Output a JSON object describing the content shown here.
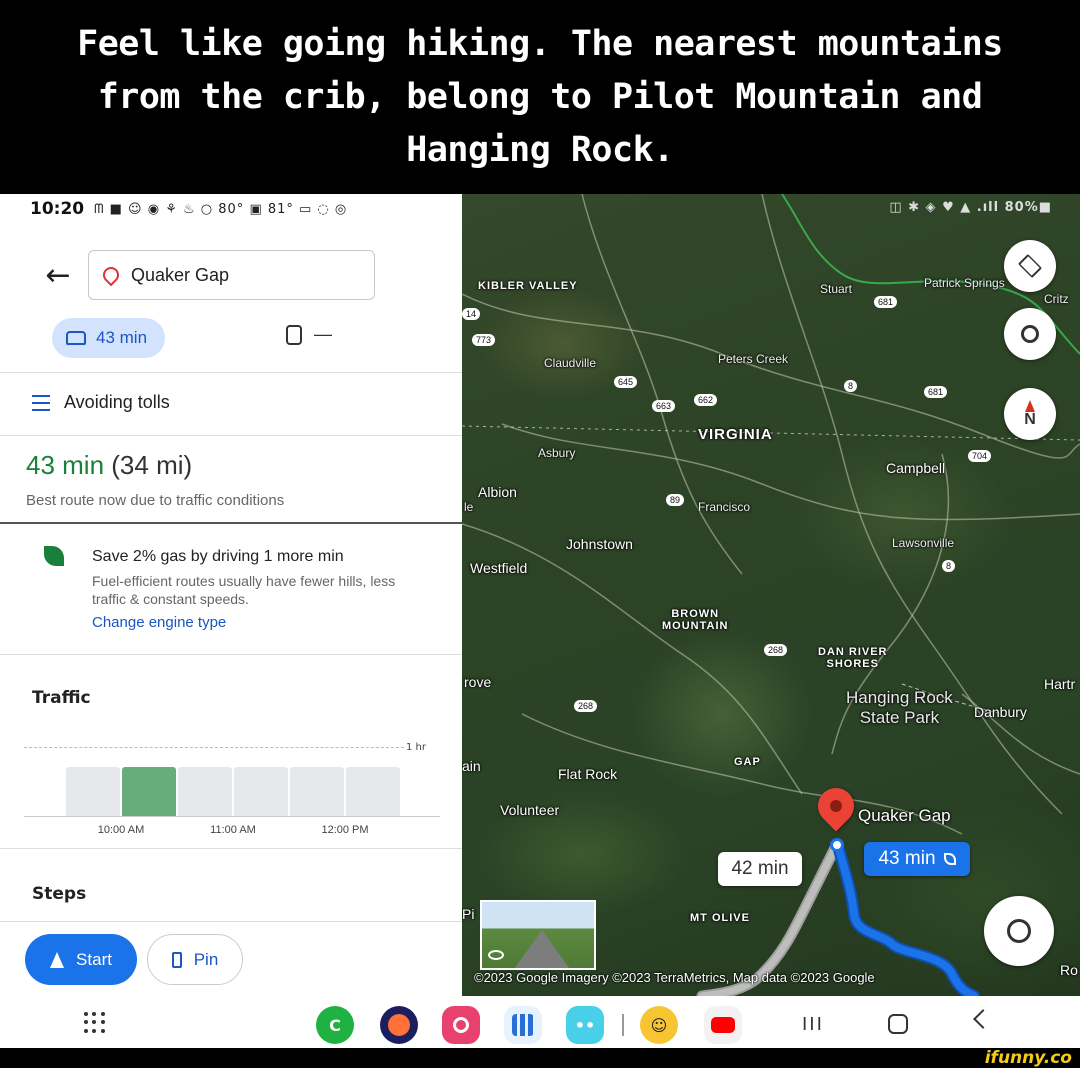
{
  "caption": "Feel like going hiking. The nearest mountains from the crib, belong to Pilot Mountain and Hanging Rock.",
  "status_bar": {
    "time": "10:20",
    "left_icons": "ᗰ ■ ☺ ◉ ⚘ ♨ ○ 80° ▣ 81° ▭ ◌ ◎"
  },
  "directions": {
    "destination": "Quaker Gap",
    "mode_time": "43 min",
    "transit_time": "—",
    "avoiding": "Avoiding tolls",
    "route_time": "43 min",
    "route_distance": " (34 mi)",
    "route_note": "Best route now due to traffic conditions",
    "eco_title": "Save 2% gas by driving 1 more min",
    "eco_desc": "Fuel-efficient routes usually have fewer hills, less traffic & constant speeds.",
    "eco_link": "Change engine type"
  },
  "traffic": {
    "title": "Traffic",
    "hour_marker": "1 hr",
    "bar_levels": [
      0.95,
      0.95,
      0.95,
      0.95,
      0.95,
      0.95
    ],
    "current_index": 1,
    "tick_labels": [
      "10:00 AM",
      "11:00 AM",
      "12:00 PM"
    ]
  },
  "steps": {
    "title": "Steps"
  },
  "buttons": {
    "start": "Start",
    "pin": "Pin"
  },
  "map": {
    "status_right": "◫ ✱ ◈ ♥ ▲ .ıll 80%■",
    "places": {
      "kibler_valley": "KIBLER VALLEY",
      "stuart": "Stuart",
      "patrick_springs": "Patrick Springs",
      "critz": "Critz",
      "claudville": "Claudville",
      "peters_creek": "Peters Creek",
      "virginia": "VIRGINIA",
      "asbury": "Asbury",
      "campbell": "Campbell",
      "albion": "Albion",
      "francisco": "Francisco",
      "johnstown": "Johnstown",
      "lawsonville": "Lawsonville",
      "westfield": "Westfield",
      "brown_mountain": "BROWN\nMOUNTAIN",
      "dan_river_shores": "DAN RIVER\nSHORES",
      "rove": "rove",
      "hanging_rock": "Hanging Rock\nState Park",
      "danbury": "Danbury",
      "hartr": "Hartr",
      "ain": "ain",
      "flat_rock": "Flat Rock",
      "gap": "GAP",
      "volunteer": "Volunteer",
      "quaker_gap": "Quaker Gap",
      "mt_olive": "MT OLIVE",
      "pi": "Pi",
      "ro": "Ro",
      "le": "le"
    },
    "shields": [
      "773",
      "645",
      "663",
      "662",
      "8",
      "681",
      "704",
      "89",
      "8",
      "268",
      "268",
      "681",
      "14"
    ],
    "route_label_alt": "42 min",
    "route_label_main": "43 min",
    "attribution": "©2023 Google  Imagery ©2023 TerraMetrics, Map data ©2023 Google"
  },
  "colors": {
    "route_main": "#1a73e8",
    "route_alt": "#bdbdbd",
    "traffic_current": "#67ad7c",
    "time_green": "#188038",
    "link_blue": "#1a56c5",
    "watermark": "#f2cc1b"
  },
  "navbar": {
    "recents": "III"
  },
  "watermark": "ifunny.co"
}
